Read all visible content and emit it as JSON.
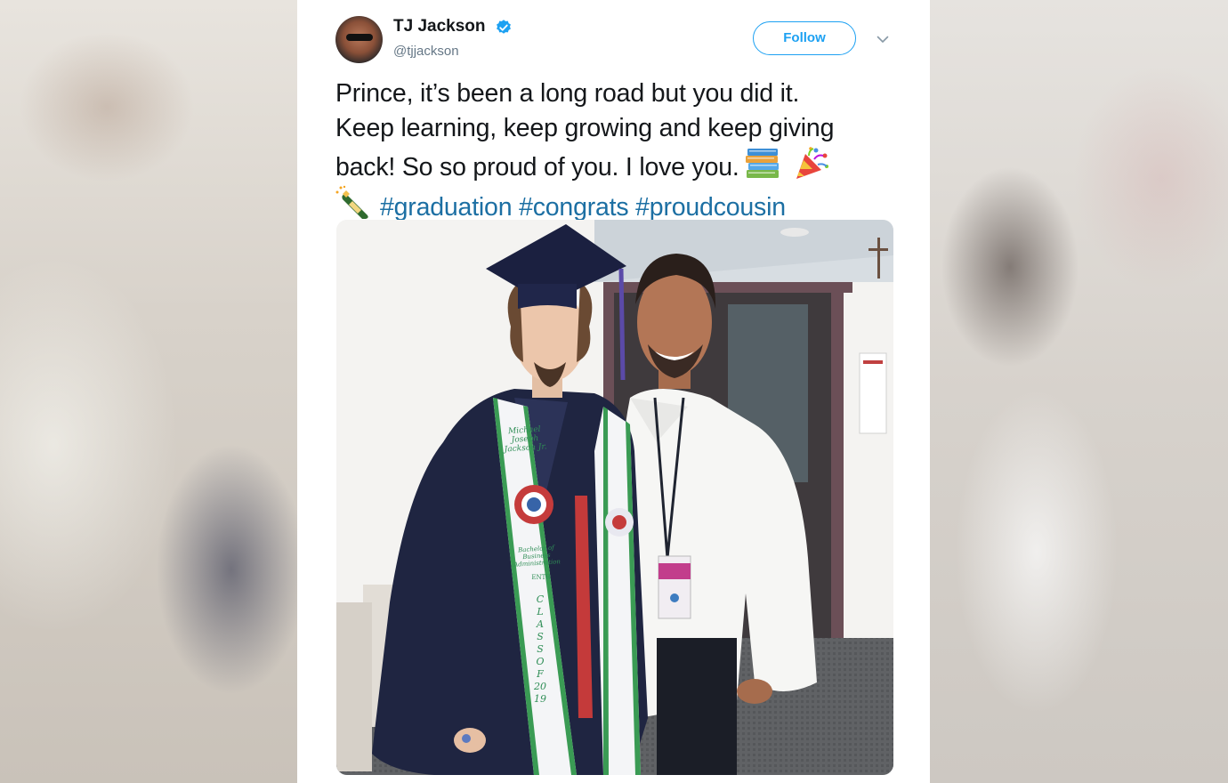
{
  "tweet": {
    "display_name": "TJ Jackson",
    "handle": "@tjjackson",
    "follow_label": "Follow",
    "text_lines": [
      "Prince, it’s been a long road but you did it.",
      "Keep learning, keep growing and keep giving",
      "back! So so proud of you. I love you."
    ],
    "hashtags": [
      "#graduation",
      "#congrats",
      "#proudcousin"
    ],
    "icons": {
      "verified": "verified-badge-icon",
      "more": "chevron-down-icon",
      "emoji_1": "books-emoji",
      "emoji_2": "party-popper-emoji",
      "emoji_3": "champagne-bottle-emoji"
    },
    "stole_text": {
      "left_name": "Michael Joseph Jackson Jr.",
      "left_degree": "Bachelor of Business Administration",
      "left_extra": "ENTR",
      "left_class": "CLASS OF 2019"
    },
    "colors": {
      "link": "#1b95e0",
      "text": "#14171a",
      "secondary": "#657786",
      "verified": "#1da1f2"
    }
  }
}
